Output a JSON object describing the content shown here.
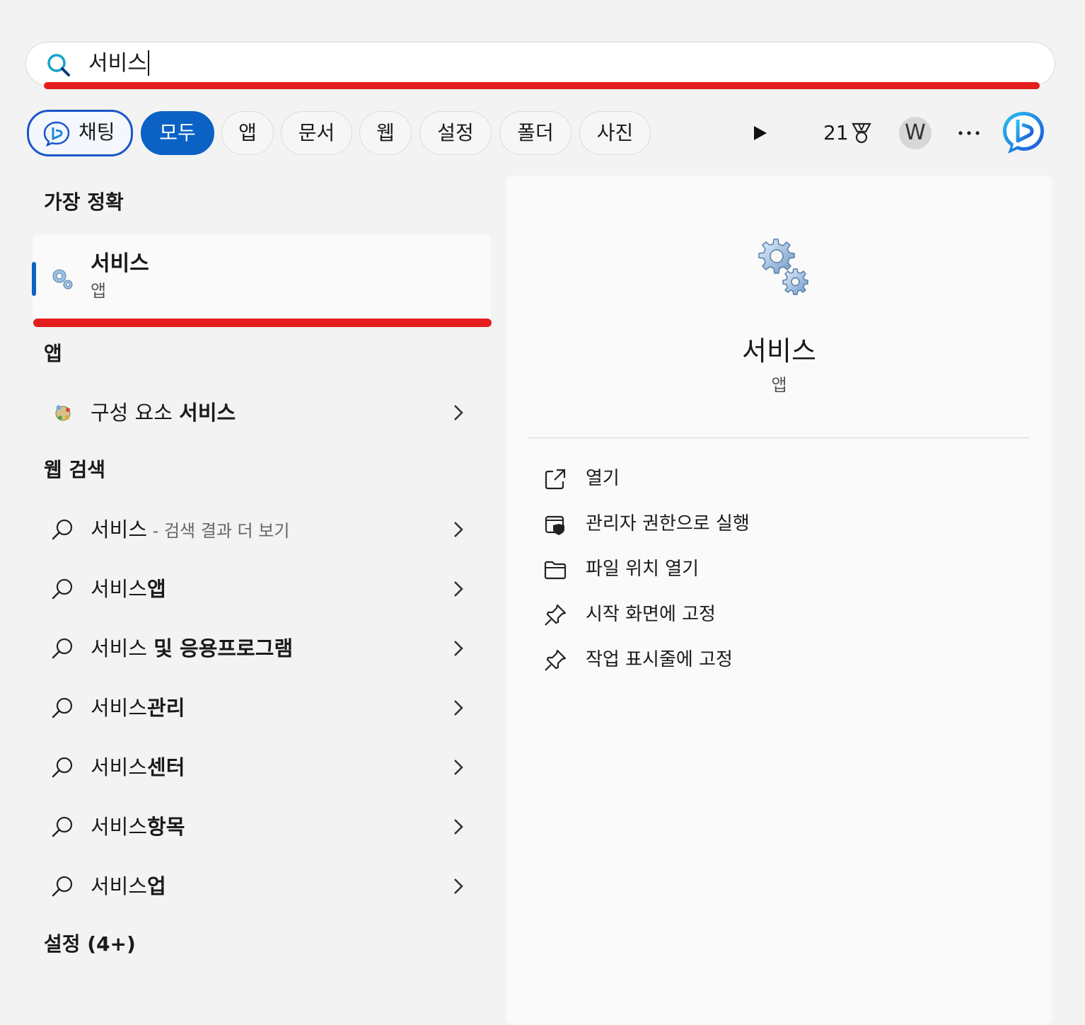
{
  "search": {
    "query": "서비스"
  },
  "filters": {
    "chat": "채팅",
    "tabs": [
      "모두",
      "앱",
      "문서",
      "웹",
      "설정",
      "폴더",
      "사진"
    ],
    "points": "21",
    "avatar": "W"
  },
  "left": {
    "best_match_heading": "가장 정확",
    "best_match": {
      "title": "서비스",
      "subtitle": "앱"
    },
    "apps_heading": "앱",
    "apps": [
      {
        "prefix": "구성 요소 ",
        "bold": "서비스"
      }
    ],
    "web_heading": "웹 검색",
    "web_items": [
      {
        "main": "서비스",
        "bold": "",
        "dim": " - 검색 결과 더 보기"
      },
      {
        "main": "서비스",
        "bold": "앱",
        "dim": ""
      },
      {
        "main": "서비스 ",
        "bold": "및 응용프로그램",
        "dim": ""
      },
      {
        "main": "서비스",
        "bold": "관리",
        "dim": ""
      },
      {
        "main": "서비스",
        "bold": "센터",
        "dim": ""
      },
      {
        "main": "서비스",
        "bold": "항목",
        "dim": ""
      },
      {
        "main": "서비스",
        "bold": "업",
        "dim": ""
      }
    ],
    "settings_heading": "설정 (4+)"
  },
  "right": {
    "title": "서비스",
    "subtitle": "앱",
    "actions": [
      {
        "icon": "open-external-icon",
        "label": "열기"
      },
      {
        "icon": "admin-shield-icon",
        "label": "관리자 권한으로 실행"
      },
      {
        "icon": "folder-icon",
        "label": "파일 위치 열기"
      },
      {
        "icon": "pin-icon",
        "label": "시작 화면에 고정"
      },
      {
        "icon": "pin-icon",
        "label": "작업 표시줄에 고정"
      }
    ]
  },
  "colors": {
    "accent": "#0b62c4",
    "highlight_red": "#e41e1e",
    "background": "#f3f3f3"
  }
}
